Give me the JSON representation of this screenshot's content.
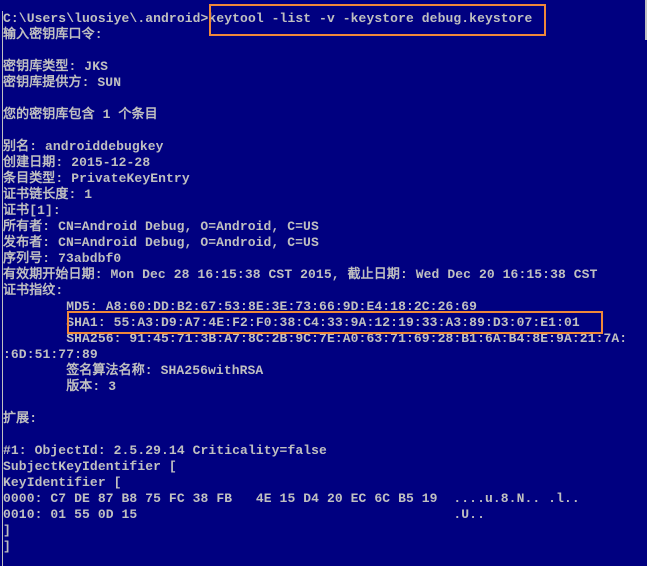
{
  "console": {
    "background": "#000080",
    "text_color": "#c0c0c0",
    "highlight_color": "#f0883a",
    "lines": [
      "C:\\Users\\luosiye\\.android>keytool -list -v -keystore debug.keystore",
      "输入密钥库口令:",
      "",
      "密钥库类型: JKS",
      "密钥库提供方: SUN",
      "",
      "您的密钥库包含 1 个条目",
      "",
      "别名: androiddebugkey",
      "创建日期: 2015-12-28",
      "条目类型: PrivateKeyEntry",
      "证书链长度: 1",
      "证书[1]:",
      "所有者: CN=Android Debug, O=Android, C=US",
      "发布者: CN=Android Debug, O=Android, C=US",
      "序列号: 73abdbf0",
      "有效期开始日期: Mon Dec 28 16:15:38 CST 2015, 截止日期: Wed Dec 20 16:15:38 CST",
      "证书指纹:",
      "        MD5: A8:60:DD:B2:67:53:8E:3E:73:66:9D:E4:18:2C:26:69",
      "        SHA1: 55:A3:D9:A7:4E:F2:F0:38:C4:33:9A:12:19:33:A3:89:D3:07:E1:01",
      "        SHA256: 91:45:71:3B:A7:8C:2B:9C:7E:A0:63:71:69:28:B1:6A:B4:8E:9A:21:7A:",
      ":6D:51:77:89",
      "        签名算法名称: SHA256withRSA",
      "        版本: 3",
      "",
      "扩展:",
      "",
      "#1: ObjectId: 2.5.29.14 Criticality=false",
      "SubjectKeyIdentifier [",
      "KeyIdentifier [",
      "0000: C7 DE 87 B8 75 FC 38 FB   4E 15 D4 20 EC 6C B5 19  ....u.8.N.. .l..",
      "0010: 01 55 0D 15                                        .U..",
      "]",
      "]"
    ]
  }
}
